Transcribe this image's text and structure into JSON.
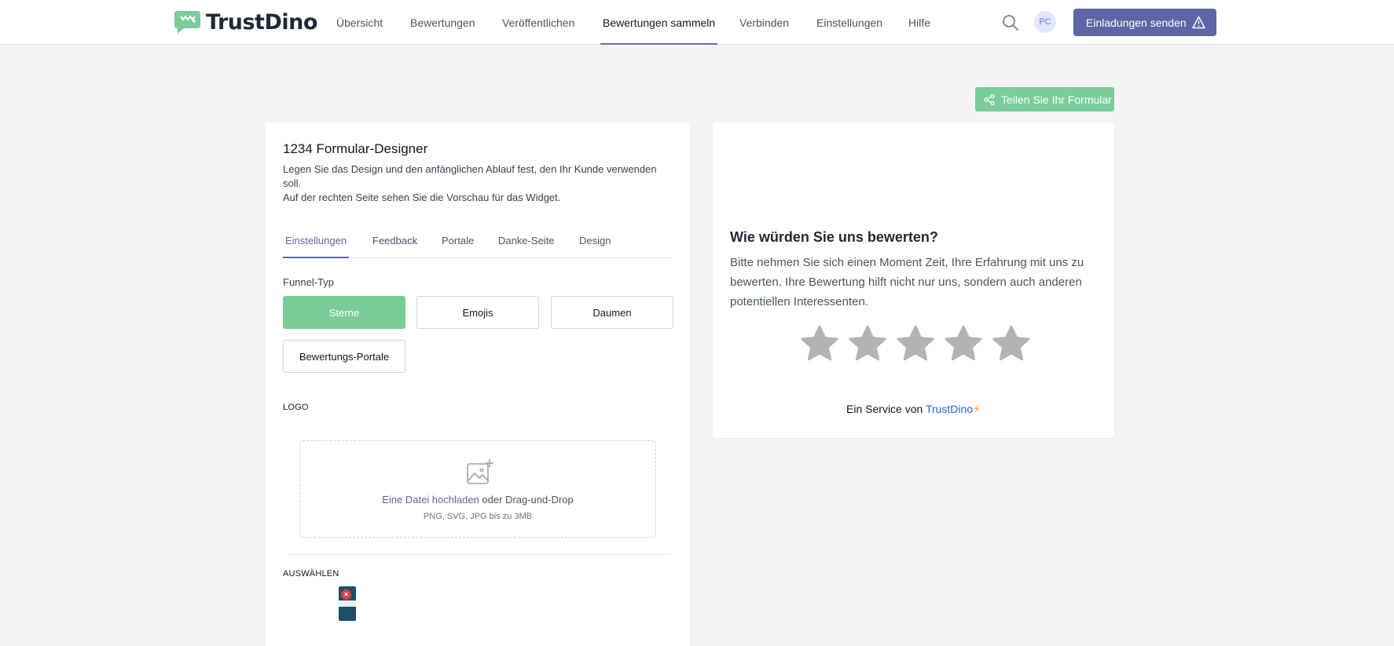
{
  "header": {
    "brand": "TrustDino",
    "nav": [
      {
        "label": "Übersicht",
        "active": false
      },
      {
        "label": "Bewertungen",
        "active": false
      },
      {
        "label": "Veröffentlichen",
        "active": false
      },
      {
        "label": "Bewertungen sammeln",
        "active": true
      },
      {
        "label": "Verbinden",
        "active": false
      },
      {
        "label": "Einstellungen",
        "active": false
      },
      {
        "label": "Hilfe",
        "active": false
      }
    ],
    "avatar_initials": "PC",
    "invite_label": "Einladungen senden"
  },
  "share_label": "Teilen Sie Ihr Formular",
  "designer": {
    "title": "1234 Formular-Designer",
    "desc_line1": "Legen Sie das Design und den anfänglichen Ablauf fest, den Ihr Kunde verwenden soll.",
    "desc_line2": "Auf der rechten Seite sehen Sie die Vorschau für das Widget.",
    "tabs": [
      {
        "label": "Einstellungen",
        "active": true
      },
      {
        "label": "Feedback",
        "active": false
      },
      {
        "label": "Portale",
        "active": false
      },
      {
        "label": "Danke-Seite",
        "active": false
      },
      {
        "label": "Design",
        "active": false
      }
    ],
    "funnel_label": "Funnel-Typ",
    "funnel_options": [
      {
        "label": "Sterne",
        "selected": true
      },
      {
        "label": "Emojis",
        "selected": false
      },
      {
        "label": "Daumen",
        "selected": false
      },
      {
        "label": "Bewertungs-Portale",
        "selected": false
      }
    ],
    "logo_label": "LOGO",
    "upload_link": "Eine Datei hochladen",
    "upload_rest": " oder Drag-und-Drop",
    "upload_hint": "PNG, SVG, JPG bis zu 3MB",
    "select_label": "AUSWÄHLEN"
  },
  "preview": {
    "title": "Wie würden Sie uns bewerten?",
    "text": "Bitte nehmen Sie sich einen Moment Zeit, Ihre Erfahrung mit uns zu bewerten. Ihre Bewertung hilft nicht nur uns, sondern auch anderen potentiellen Interessenten.",
    "star_count": 5,
    "service_prefix": "Ein Service von ",
    "service_brand": "TrustDino",
    "service_icon": "⚡"
  },
  "colors": {
    "accent": "#5f64a4",
    "green": "#79cd99",
    "star": "#b3b3b3",
    "link": "#2563eb"
  },
  "icons": {
    "brand": "dino-logo-icon",
    "search": "search-icon",
    "invite": "warning-triangle-icon",
    "share": "share-icon",
    "upload": "image-plus-icon",
    "remove": "close-icon"
  }
}
